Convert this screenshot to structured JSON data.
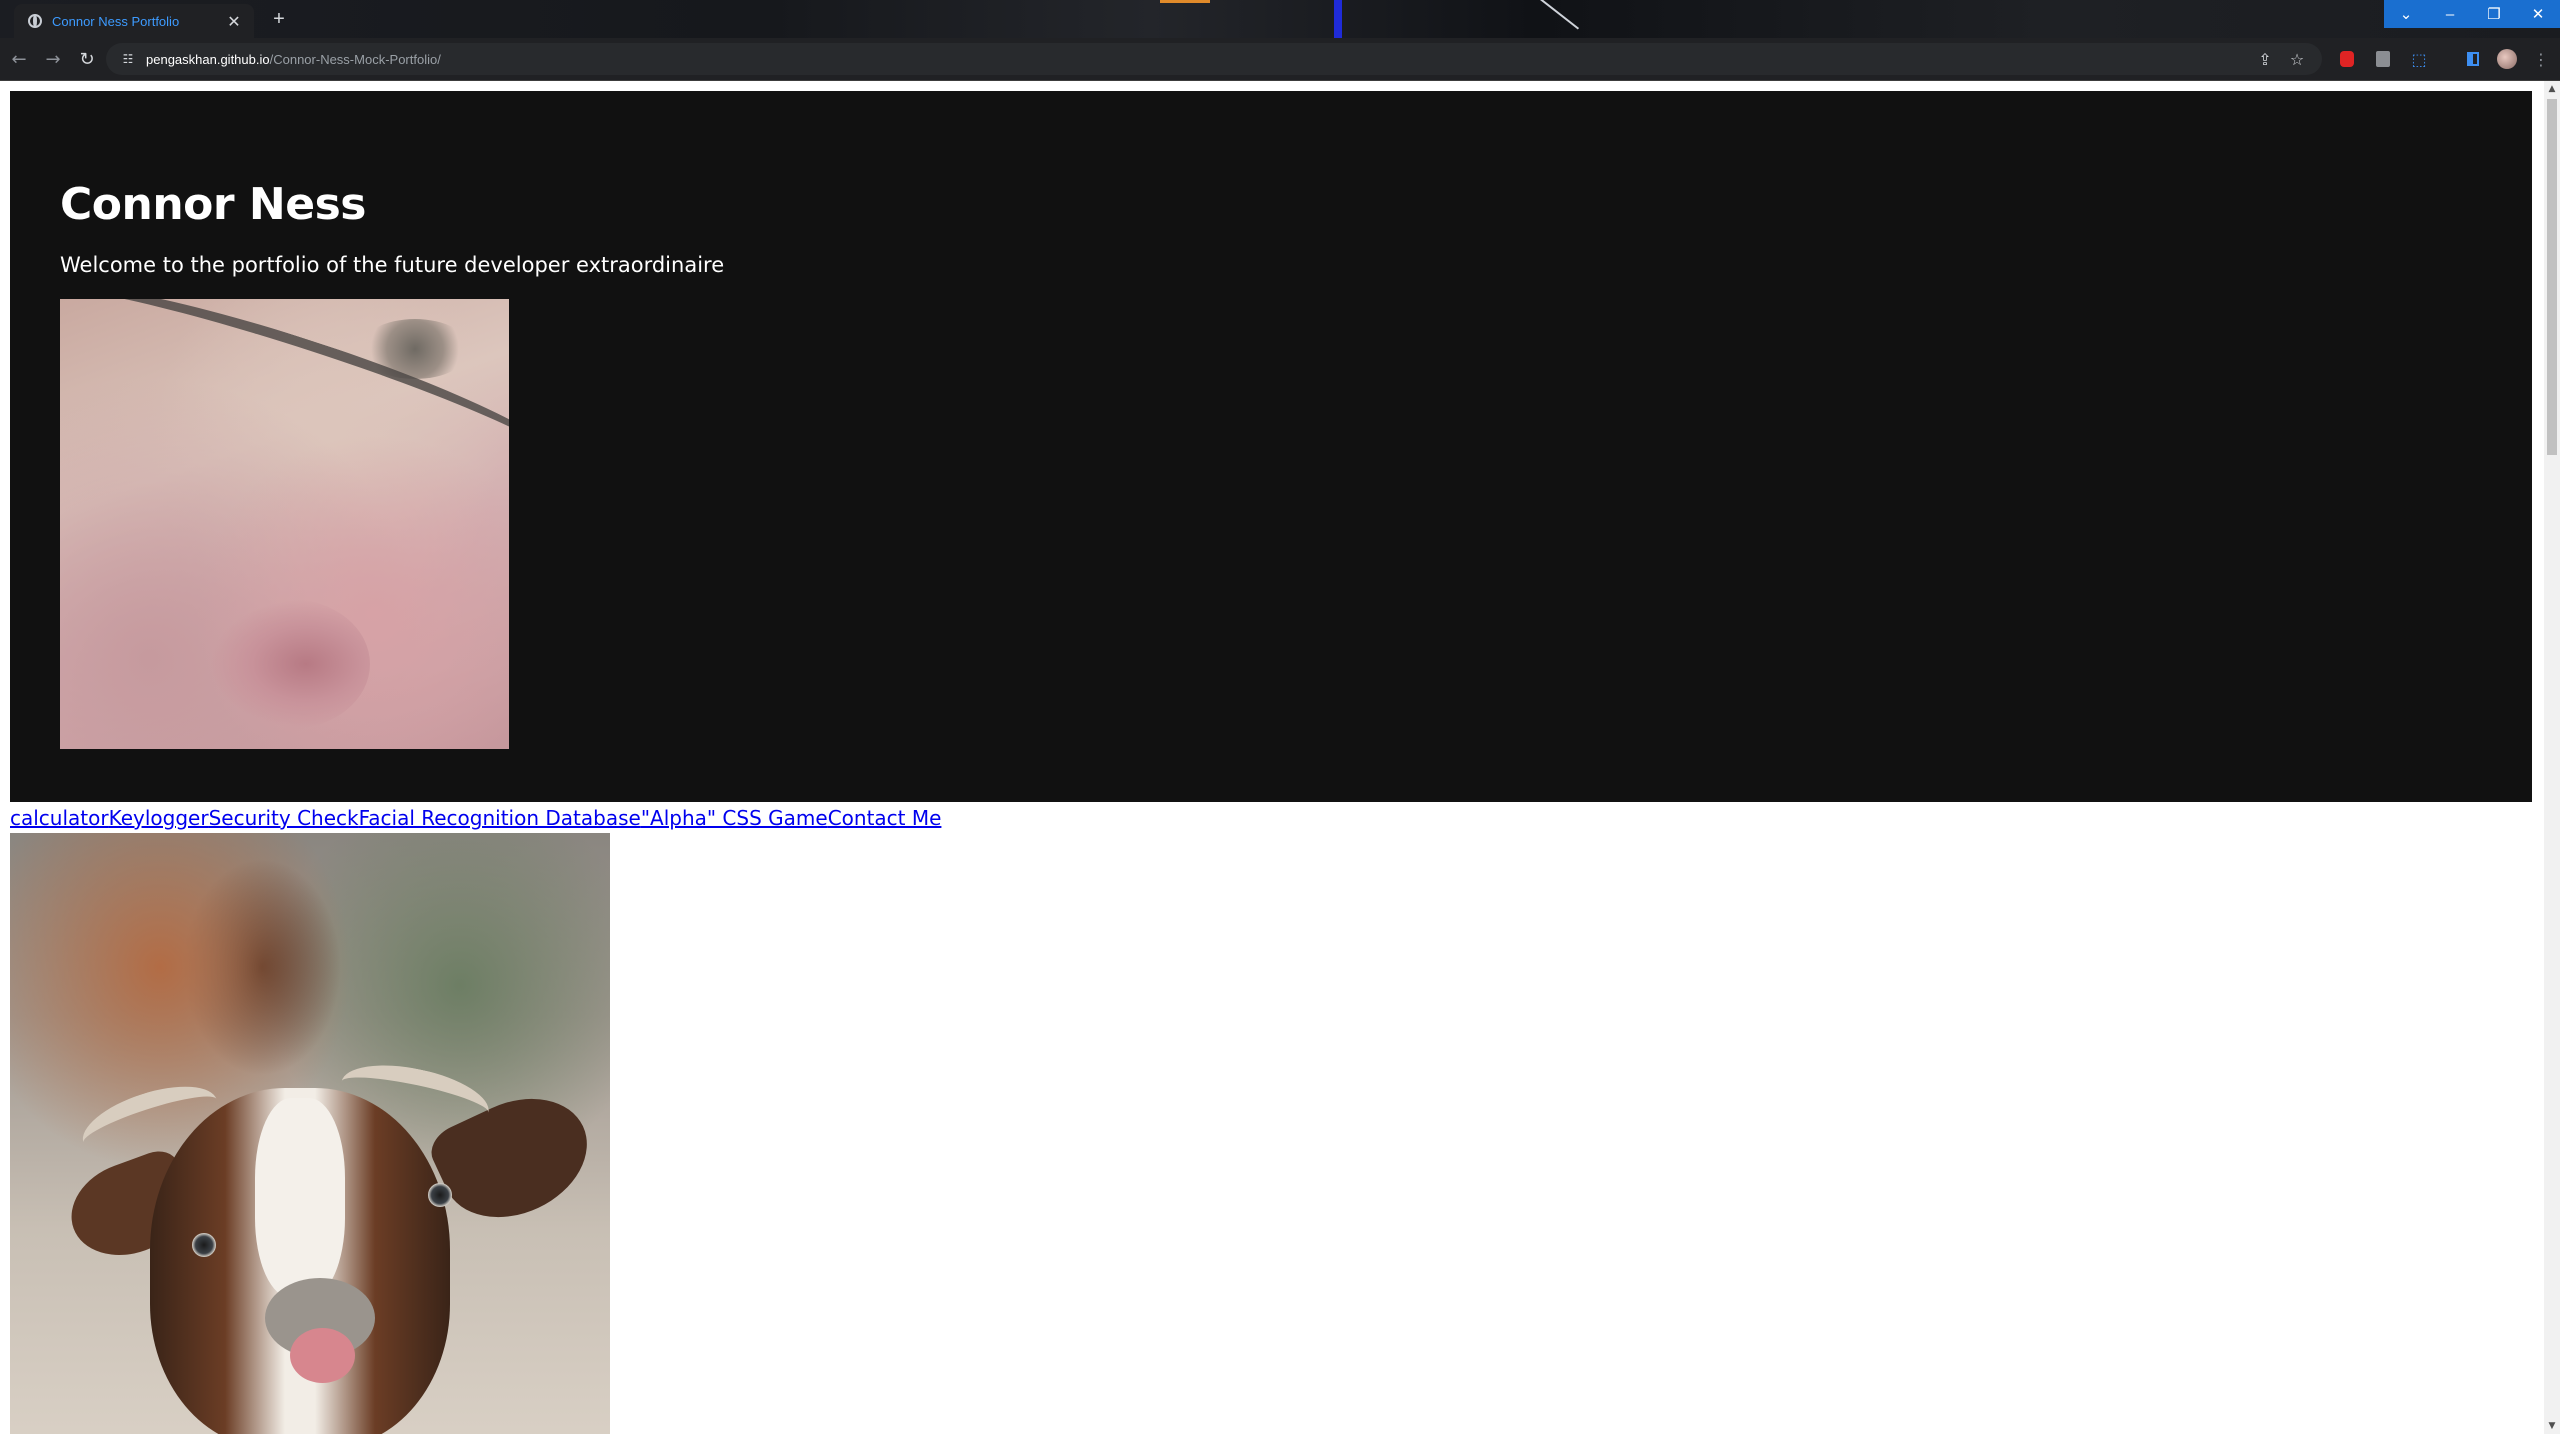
{
  "browser": {
    "tab_title": "Connor Ness Portfolio",
    "tab_close": "✕",
    "new_tab": "+",
    "url_host": "pengaskhan.github.io",
    "url_path": "/Connor-Ness-Mock-Portfolio/",
    "window_controls": {
      "tab_search": "⌄",
      "minimize": "–",
      "restore": "❐",
      "close": "✕"
    }
  },
  "page": {
    "heading": "Connor Ness",
    "tagline": "Welcome to the portfolio of the future developer extraordinaire",
    "nav_links": [
      "calculator",
      "Keylogger",
      "Security Check",
      "Facial Recognition Database",
      "\"Alpha\" CSS Game",
      "Contact Me"
    ]
  },
  "icons": {
    "back": "back-arrow-icon",
    "forward": "forward-arrow-icon",
    "reload": "reload-icon",
    "site_info": "site-settings-icon",
    "share": "share-icon",
    "bookmark": "star-icon",
    "extension_red": "extension-icon",
    "extension_gray": "extension-icon",
    "extensions": "puzzle-icon",
    "side_panel": "side-panel-icon",
    "profile": "avatar",
    "menu": "kebab-menu-icon"
  },
  "colors": {
    "header_bg": "#111111",
    "link": "#0000ee",
    "tab_title": "#3d9bff",
    "window_controls": "#1a6fd0"
  }
}
